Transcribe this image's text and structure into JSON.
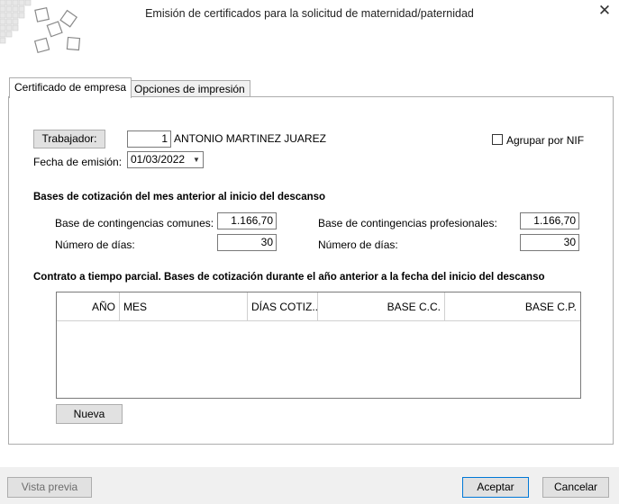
{
  "window": {
    "title": "Emisión de certificados para la solicitud de maternidad/paternidad",
    "close_label": "✕"
  },
  "tabs": [
    {
      "label": "Certificado de empresa",
      "active": true
    },
    {
      "label": "Opciones de impresión",
      "active": false
    }
  ],
  "worker": {
    "button_label": "Trabajador:",
    "code": "1",
    "name": "ANTONIO MARTINEZ JUAREZ",
    "group_nif_label": "Agrupar por NIF",
    "group_nif_checked": false
  },
  "issue_date": {
    "label": "Fecha de emisión:",
    "value": "01/03/2022"
  },
  "bases": {
    "heading": "Bases de cotización del mes anterior al inicio del descanso",
    "common_label": "Base de contingencias comunes:",
    "common_value": "1.166,70",
    "common_days_label": "Número de días:",
    "common_days_value": "30",
    "professional_label": "Base de contingencias profesionales:",
    "professional_value": "1.166,70",
    "professional_days_label": "Número de días:",
    "professional_days_value": "30"
  },
  "partial": {
    "heading": "Contrato a tiempo parcial. Bases de cotización durante el año anterior a la fecha del inicio del descanso",
    "columns": [
      "AÑO",
      "MES",
      "DÍAS COTIZ...",
      "BASE C.C.",
      "BASE C.P."
    ],
    "rows": [],
    "new_button": "Nueva"
  },
  "footer": {
    "preview_label": "Vista previa",
    "accept_label": "Aceptar",
    "cancel_label": "Cancelar"
  }
}
